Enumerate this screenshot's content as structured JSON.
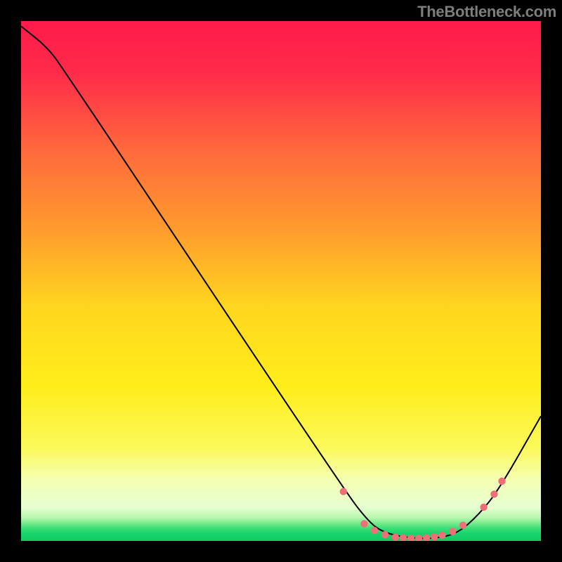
{
  "attribution": "TheBottleneck.com",
  "chart_data": {
    "type": "line",
    "title": "",
    "xlabel": "",
    "ylabel": "",
    "xlim": [
      0,
      100
    ],
    "ylim": [
      0,
      100
    ],
    "colors": {
      "top": "#ff1a4a",
      "mid": "#ffea00",
      "low_band": "#f5ffcc",
      "bottom": "#18d66b",
      "line": "#000000",
      "marker": "#ef6f78"
    },
    "curve": [
      {
        "x": 0,
        "y": 99
      },
      {
        "x": 5,
        "y": 95
      },
      {
        "x": 8,
        "y": 91
      },
      {
        "x": 62,
        "y": 10
      },
      {
        "x": 67,
        "y": 3.5
      },
      {
        "x": 70,
        "y": 1.5
      },
      {
        "x": 75,
        "y": 0.5
      },
      {
        "x": 80,
        "y": 0.5
      },
      {
        "x": 84,
        "y": 1.5
      },
      {
        "x": 88,
        "y": 5
      },
      {
        "x": 92,
        "y": 10
      },
      {
        "x": 100,
        "y": 24
      }
    ],
    "markers": [
      {
        "x": 62,
        "y": 9.5
      },
      {
        "x": 66,
        "y": 3.3
      },
      {
        "x": 68,
        "y": 2.0
      },
      {
        "x": 70,
        "y": 1.2
      },
      {
        "x": 72,
        "y": 0.7
      },
      {
        "x": 73.5,
        "y": 0.6
      },
      {
        "x": 75,
        "y": 0.5
      },
      {
        "x": 76.5,
        "y": 0.5
      },
      {
        "x": 78,
        "y": 0.6
      },
      {
        "x": 79.5,
        "y": 0.8
      },
      {
        "x": 81,
        "y": 1.1
      },
      {
        "x": 83,
        "y": 1.8
      },
      {
        "x": 85,
        "y": 3.0
      },
      {
        "x": 89,
        "y": 6.5
      },
      {
        "x": 91,
        "y": 9.0
      },
      {
        "x": 92.5,
        "y": 11.5
      }
    ]
  }
}
